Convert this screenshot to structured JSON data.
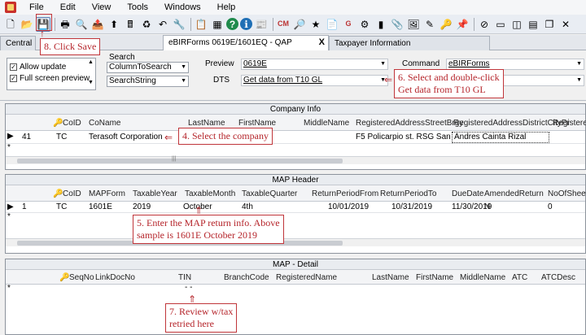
{
  "menu": [
    "File",
    "Edit",
    "View",
    "Tools",
    "Windows",
    "Help"
  ],
  "toolbar_icons": [
    {
      "name": "new-file-icon",
      "glyph": "🗋"
    },
    {
      "name": "open-folder-icon",
      "glyph": "📂"
    },
    {
      "name": "save-icon",
      "glyph": "💾"
    },
    {
      "name": "print-icon",
      "glyph": "🖶"
    },
    {
      "name": "print-preview-icon",
      "glyph": "🔍"
    },
    {
      "name": "export-icon",
      "glyph": "📤"
    },
    {
      "name": "upload-icon",
      "glyph": "⬆"
    },
    {
      "name": "calculator-icon",
      "glyph": "🖩"
    },
    {
      "name": "refresh-icon",
      "glyph": "♻"
    },
    {
      "name": "undo-icon",
      "glyph": "↶"
    },
    {
      "name": "tools-icon",
      "glyph": "🔧"
    },
    {
      "name": "clipboard-icon",
      "glyph": "📋"
    },
    {
      "name": "spreadsheet-icon",
      "glyph": "▦"
    },
    {
      "name": "help-icon",
      "glyph": "?"
    },
    {
      "name": "info-icon",
      "glyph": "ℹ"
    },
    {
      "name": "report-icon",
      "glyph": "📰"
    },
    {
      "name": "cm-icon",
      "glyph": "CM"
    },
    {
      "name": "zoom-icon",
      "glyph": "🔎"
    },
    {
      "name": "favorite-icon",
      "glyph": "★"
    },
    {
      "name": "document-icon",
      "glyph": "📄"
    },
    {
      "name": "g-icon",
      "glyph": "G"
    },
    {
      "name": "settings-icon",
      "glyph": "⚙"
    },
    {
      "name": "stamp-icon",
      "glyph": "▮"
    },
    {
      "name": "attach-icon",
      "glyph": "📎"
    },
    {
      "name": "image-icon",
      "glyph": "🖼"
    },
    {
      "name": "edit-icon",
      "glyph": "✎"
    },
    {
      "name": "key-icon",
      "glyph": "🔑"
    },
    {
      "name": "pin-icon",
      "glyph": "📌"
    },
    {
      "name": "cancel-icon",
      "glyph": "⊘"
    },
    {
      "name": "window-icon",
      "glyph": "▭"
    },
    {
      "name": "split-window-icon",
      "glyph": "◫"
    },
    {
      "name": "tile-window-icon",
      "glyph": "▤"
    },
    {
      "name": "cascade-window-icon",
      "glyph": "❐"
    },
    {
      "name": "close-window-icon",
      "glyph": "✕"
    }
  ],
  "tabs": {
    "central": "Central",
    "active": "eBIRForms 0619E/1601EQ - QAP",
    "taxpayer": "Taxpayer Information",
    "close_glyph": "X"
  },
  "options": {
    "allow_update": "Allow update",
    "full_screen_preview": "Full screen preview"
  },
  "search": {
    "label": "Search",
    "column": "ColumnToSearch",
    "string": "SearchString"
  },
  "preview": {
    "label": "Preview",
    "value": "0619E"
  },
  "dts": {
    "label": "DTS",
    "value": "Get data from T10 GL"
  },
  "command": {
    "label": "Command",
    "value": "eBIRForms"
  },
  "company_info": {
    "title": "Company Info",
    "headers": [
      "CoID",
      "CoName",
      "LastName",
      "FirstName",
      "MiddleName",
      "RegisteredAddressStreetBrgy",
      "RegisteredAddressDistrictCityPr",
      "RegisteredA"
    ],
    "row": {
      "id": "41",
      "coid": "TC",
      "coname": "Terasoft Corporation",
      "street": "F5 Policarpio st. RSG San",
      "district": "Andres Cainta Rizal"
    }
  },
  "map_header": {
    "title": "MAP Header",
    "headers": [
      "CoID",
      "MAPForm",
      "TaxableYear",
      "TaxableMonth",
      "TaxableQuarter",
      "ReturnPeriodFrom",
      "ReturnPeriodTo",
      "DueDate",
      "AmendedReturn",
      "NoOfSheets"
    ],
    "row": {
      "id": "1",
      "coid": "TC",
      "form": "1601E",
      "year": "2019",
      "month": "October",
      "quarter": "4th",
      "from": "10/01/2019",
      "to": "10/31/2019",
      "due": "11/30/2019",
      "amended": "N",
      "sheets": "0"
    }
  },
  "map_detail": {
    "title": "MAP - Detail",
    "headers": [
      "SeqNo",
      "LinkDocNo",
      "TIN",
      "BranchCode",
      "RegisteredName",
      "LastName",
      "FirstName",
      "MiddleName",
      "ATC",
      "ATCDesc"
    ],
    "tin_mask": "-   -"
  },
  "callouts": {
    "save": "8. Click Save",
    "select_dts": "6. Select and double-click",
    "select_dts_2": "Get data from T10 GL",
    "select_company": "4. Select the company",
    "map_info": "5. Enter the MAP return info. Above",
    "map_info_2": "sample is 1601E October 2019",
    "review": "7. Review w/tax",
    "review_2": "retried here"
  },
  "row_indicator": "▶",
  "new_row_indicator": "*",
  "key_glyph": "🔑"
}
